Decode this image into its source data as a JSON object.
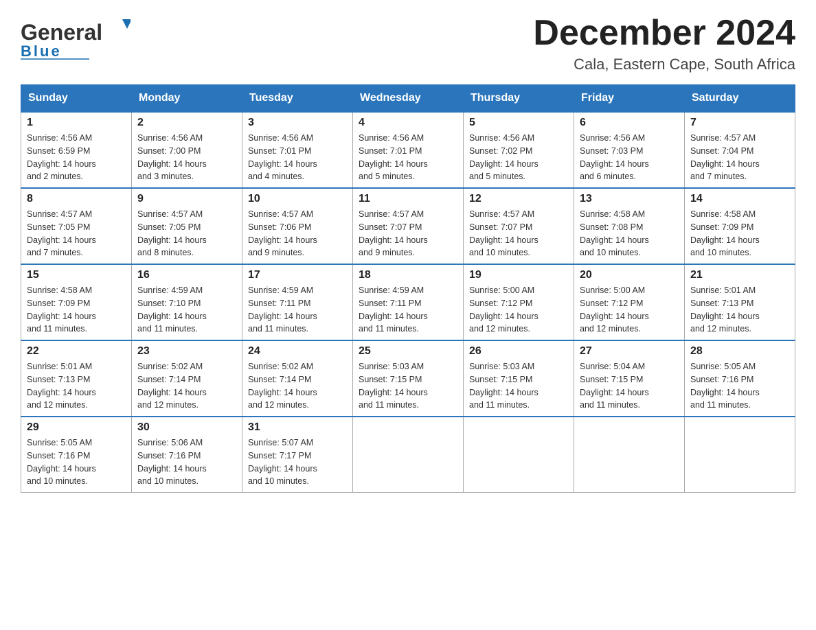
{
  "header": {
    "logo_general": "General",
    "logo_blue": "Blue",
    "title": "December 2024",
    "subtitle": "Cala, Eastern Cape, South Africa"
  },
  "weekdays": [
    "Sunday",
    "Monday",
    "Tuesday",
    "Wednesday",
    "Thursday",
    "Friday",
    "Saturday"
  ],
  "weeks": [
    [
      {
        "day": "1",
        "sunrise": "4:56 AM",
        "sunset": "6:59 PM",
        "daylight": "14 hours and 2 minutes."
      },
      {
        "day": "2",
        "sunrise": "4:56 AM",
        "sunset": "7:00 PM",
        "daylight": "14 hours and 3 minutes."
      },
      {
        "day": "3",
        "sunrise": "4:56 AM",
        "sunset": "7:01 PM",
        "daylight": "14 hours and 4 minutes."
      },
      {
        "day": "4",
        "sunrise": "4:56 AM",
        "sunset": "7:01 PM",
        "daylight": "14 hours and 5 minutes."
      },
      {
        "day": "5",
        "sunrise": "4:56 AM",
        "sunset": "7:02 PM",
        "daylight": "14 hours and 5 minutes."
      },
      {
        "day": "6",
        "sunrise": "4:56 AM",
        "sunset": "7:03 PM",
        "daylight": "14 hours and 6 minutes."
      },
      {
        "day": "7",
        "sunrise": "4:57 AM",
        "sunset": "7:04 PM",
        "daylight": "14 hours and 7 minutes."
      }
    ],
    [
      {
        "day": "8",
        "sunrise": "4:57 AM",
        "sunset": "7:05 PM",
        "daylight": "14 hours and 7 minutes."
      },
      {
        "day": "9",
        "sunrise": "4:57 AM",
        "sunset": "7:05 PM",
        "daylight": "14 hours and 8 minutes."
      },
      {
        "day": "10",
        "sunrise": "4:57 AM",
        "sunset": "7:06 PM",
        "daylight": "14 hours and 9 minutes."
      },
      {
        "day": "11",
        "sunrise": "4:57 AM",
        "sunset": "7:07 PM",
        "daylight": "14 hours and 9 minutes."
      },
      {
        "day": "12",
        "sunrise": "4:57 AM",
        "sunset": "7:07 PM",
        "daylight": "14 hours and 10 minutes."
      },
      {
        "day": "13",
        "sunrise": "4:58 AM",
        "sunset": "7:08 PM",
        "daylight": "14 hours and 10 minutes."
      },
      {
        "day": "14",
        "sunrise": "4:58 AM",
        "sunset": "7:09 PM",
        "daylight": "14 hours and 10 minutes."
      }
    ],
    [
      {
        "day": "15",
        "sunrise": "4:58 AM",
        "sunset": "7:09 PM",
        "daylight": "14 hours and 11 minutes."
      },
      {
        "day": "16",
        "sunrise": "4:59 AM",
        "sunset": "7:10 PM",
        "daylight": "14 hours and 11 minutes."
      },
      {
        "day": "17",
        "sunrise": "4:59 AM",
        "sunset": "7:11 PM",
        "daylight": "14 hours and 11 minutes."
      },
      {
        "day": "18",
        "sunrise": "4:59 AM",
        "sunset": "7:11 PM",
        "daylight": "14 hours and 11 minutes."
      },
      {
        "day": "19",
        "sunrise": "5:00 AM",
        "sunset": "7:12 PM",
        "daylight": "14 hours and 12 minutes."
      },
      {
        "day": "20",
        "sunrise": "5:00 AM",
        "sunset": "7:12 PM",
        "daylight": "14 hours and 12 minutes."
      },
      {
        "day": "21",
        "sunrise": "5:01 AM",
        "sunset": "7:13 PM",
        "daylight": "14 hours and 12 minutes."
      }
    ],
    [
      {
        "day": "22",
        "sunrise": "5:01 AM",
        "sunset": "7:13 PM",
        "daylight": "14 hours and 12 minutes."
      },
      {
        "day": "23",
        "sunrise": "5:02 AM",
        "sunset": "7:14 PM",
        "daylight": "14 hours and 12 minutes."
      },
      {
        "day": "24",
        "sunrise": "5:02 AM",
        "sunset": "7:14 PM",
        "daylight": "14 hours and 12 minutes."
      },
      {
        "day": "25",
        "sunrise": "5:03 AM",
        "sunset": "7:15 PM",
        "daylight": "14 hours and 11 minutes."
      },
      {
        "day": "26",
        "sunrise": "5:03 AM",
        "sunset": "7:15 PM",
        "daylight": "14 hours and 11 minutes."
      },
      {
        "day": "27",
        "sunrise": "5:04 AM",
        "sunset": "7:15 PM",
        "daylight": "14 hours and 11 minutes."
      },
      {
        "day": "28",
        "sunrise": "5:05 AM",
        "sunset": "7:16 PM",
        "daylight": "14 hours and 11 minutes."
      }
    ],
    [
      {
        "day": "29",
        "sunrise": "5:05 AM",
        "sunset": "7:16 PM",
        "daylight": "14 hours and 10 minutes."
      },
      {
        "day": "30",
        "sunrise": "5:06 AM",
        "sunset": "7:16 PM",
        "daylight": "14 hours and 10 minutes."
      },
      {
        "day": "31",
        "sunrise": "5:07 AM",
        "sunset": "7:17 PM",
        "daylight": "14 hours and 10 minutes."
      },
      null,
      null,
      null,
      null
    ]
  ],
  "labels": {
    "sunrise": "Sunrise:",
    "sunset": "Sunset:",
    "daylight": "Daylight:"
  }
}
